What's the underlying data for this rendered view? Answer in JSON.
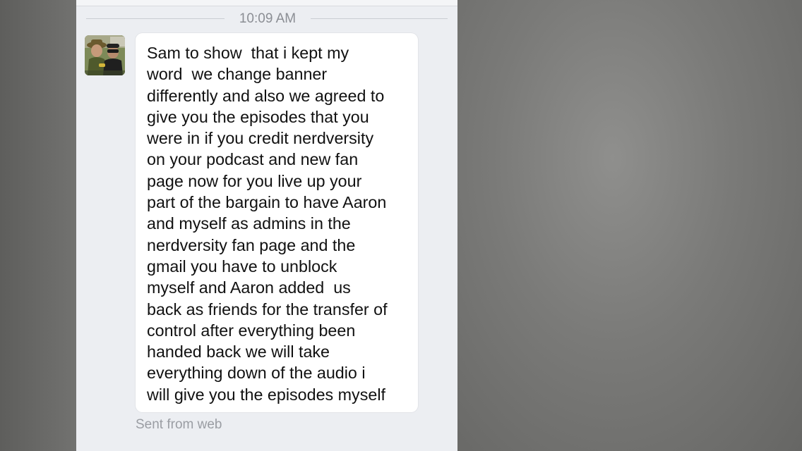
{
  "timestamp": "10:09 AM",
  "message": {
    "lines": [
      "Sam to show  that i kept my",
      "word  we change banner",
      "differently and also we agreed to",
      "give you the episodes that you",
      "were in if you credit nerdversity",
      "on your podcast and new fan",
      "page now for you live up your",
      "part of the bargain to have Aaron",
      "and myself as admins in the",
      "nerdversity fan page and the",
      "gmail you have to unblock",
      "myself and Aaron added  us",
      "back as friends for the transfer of",
      "control after everything been",
      "handed back we will take",
      "everything down of the audio i",
      "will give you the episodes myself"
    ]
  },
  "sent_from": "Sent from web",
  "colors": {
    "bubble_background": "#ffffff",
    "chat_background": "#eceef2",
    "meta_text": "#8b8e94",
    "message_text": "#111111"
  }
}
